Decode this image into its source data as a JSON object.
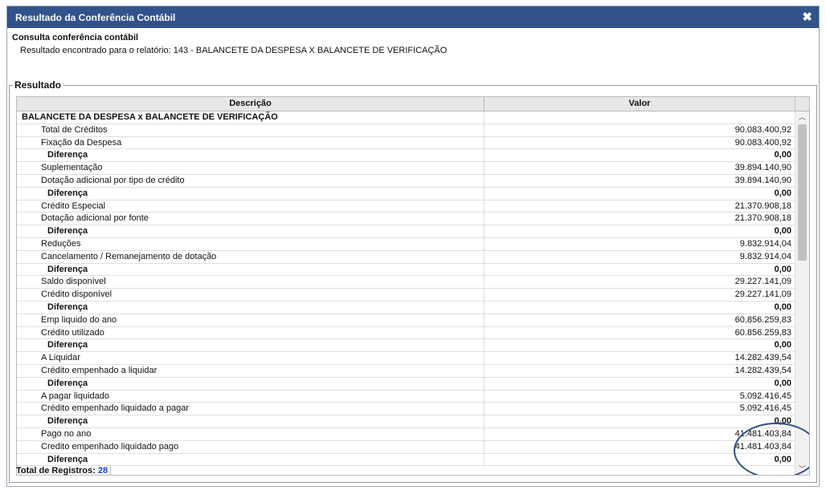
{
  "dialog": {
    "title": "Resultado da Conferência Contábil",
    "close_label": "✖",
    "heading": "Consulta conferência contábil",
    "subtitle": "Resultado encontrado para o relatório: 143 - BALANCETE DA DESPESA X BALANCETE DE VERIFICAÇÃO"
  },
  "result": {
    "legend": "Resultado",
    "columns": [
      "Descrição",
      "Valor"
    ],
    "rows": [
      {
        "type": "group",
        "desc": "BALANCETE DA DESPESA x BALANCETE DE VERIFICAÇÃO",
        "val": ""
      },
      {
        "type": "item",
        "desc": "Total de Créditos",
        "val": "90.083.400,92"
      },
      {
        "type": "item",
        "desc": "Fixação da Despesa",
        "val": "90.083.400,92"
      },
      {
        "type": "diff",
        "desc": "Diferença",
        "val": "0,00"
      },
      {
        "type": "item",
        "desc": "Suplementação",
        "val": "39.894.140,90"
      },
      {
        "type": "item",
        "desc": "Dotação adicional por tipo de crédito",
        "val": "39.894.140,90"
      },
      {
        "type": "diff",
        "desc": "Diferença",
        "val": "0,00"
      },
      {
        "type": "item",
        "desc": "Crédito Especial",
        "val": "21.370.908,18"
      },
      {
        "type": "item",
        "desc": "Dotação adicional por fonte",
        "val": "21.370.908,18"
      },
      {
        "type": "diff",
        "desc": "Diferença",
        "val": "0,00"
      },
      {
        "type": "item",
        "desc": "Reduções",
        "val": "9.832.914,04"
      },
      {
        "type": "item",
        "desc": "Cancelamento / Remanejamento de dotação",
        "val": "9.832.914,04"
      },
      {
        "type": "diff",
        "desc": "Diferença",
        "val": "0,00"
      },
      {
        "type": "item",
        "desc": "Saldo disponível",
        "val": "29.227.141,09"
      },
      {
        "type": "item",
        "desc": "Crédito disponível",
        "val": "29.227.141,09"
      },
      {
        "type": "diff",
        "desc": "Diferença",
        "val": "0,00"
      },
      {
        "type": "item",
        "desc": "Emp liquido do ano",
        "val": "60.856.259,83"
      },
      {
        "type": "item",
        "desc": "Crédito utilizado",
        "val": "60.856.259,83"
      },
      {
        "type": "diff",
        "desc": "Diferença",
        "val": "0,00"
      },
      {
        "type": "item",
        "desc": "A Liquidar",
        "val": "14.282.439,54"
      },
      {
        "type": "item",
        "desc": "Crédito empenhado a liquidar",
        "val": "14.282.439,54"
      },
      {
        "type": "diff",
        "desc": "Diferença",
        "val": "0,00"
      },
      {
        "type": "item",
        "desc": "A pagar liquidado",
        "val": "5.092.416,45"
      },
      {
        "type": "item",
        "desc": "Crédito empenhado liquidado a pagar",
        "val": "5.092.416,45"
      },
      {
        "type": "diff",
        "desc": "Diferença",
        "val": "0,00"
      },
      {
        "type": "item",
        "desc": "Pago no ano",
        "val": "41.481.403,84"
      },
      {
        "type": "item",
        "desc": "Credito empenhado liquidado pago",
        "val": "41.481.403,84"
      },
      {
        "type": "diff",
        "desc": "Diferença",
        "val": "0,00"
      }
    ]
  },
  "footer": {
    "label": "Total de Registros:",
    "count": "28"
  },
  "icons": {
    "close": "close-icon",
    "scroll_up": "chevron-up-icon",
    "scroll_down": "chevron-down-icon"
  },
  "colors": {
    "titlebar": "#31528a",
    "count": "#1a3fd6",
    "annotation": "#2f4f86"
  }
}
